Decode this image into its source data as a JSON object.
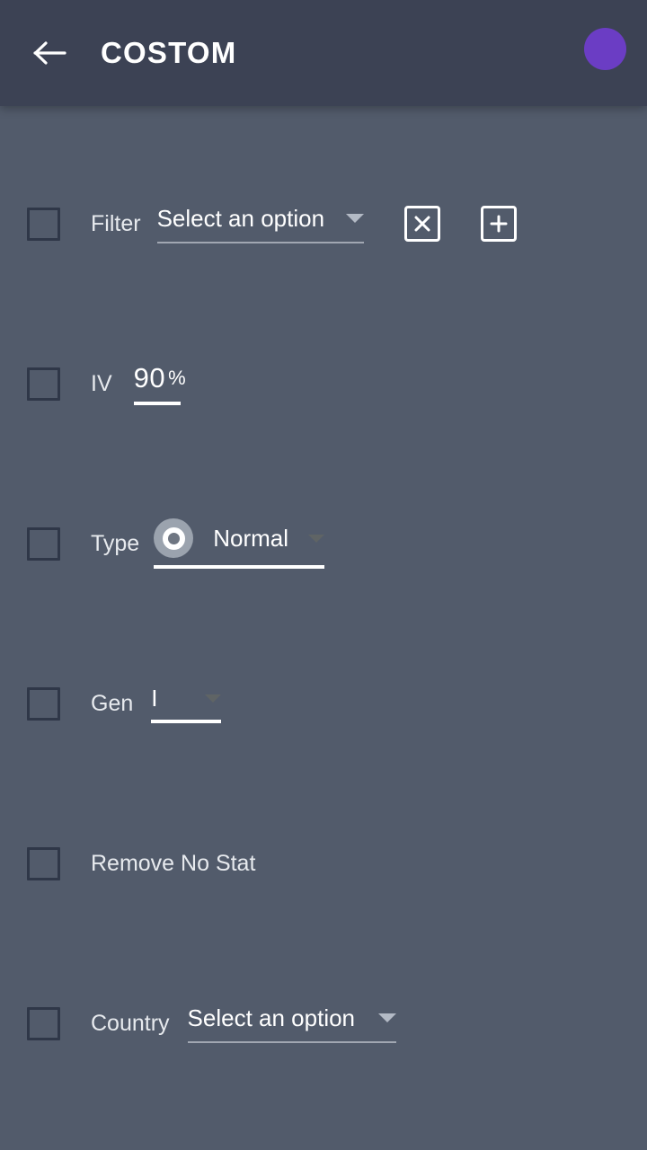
{
  "appbar": {
    "back_icon": "arrow-left-icon",
    "title": "COSTOM",
    "avatar_color": "#6b3dc4"
  },
  "theme": {
    "appbar_bg": "#3c4254",
    "body_bg": "#525b6b",
    "checkbox_border": "#2f3748",
    "text_primary": "#ffffff",
    "label_color": "#e7eaee",
    "underline_active": "#ffffff",
    "underline_inactive": "rgba(226,230,236,0.55)",
    "accent_purple": "#6b3dc4"
  },
  "form": {
    "rows": [
      {
        "name": "filter",
        "label": "Filter",
        "checked": false,
        "control": "dropdown",
        "value": "Select an option",
        "placeholder": "Select an option",
        "focused": false,
        "buttons": [
          {
            "name": "clear-filter-button",
            "icon": "close-box-icon",
            "label": "X"
          },
          {
            "name": "add-filter-button",
            "icon": "plus-box-icon",
            "label": "+"
          }
        ]
      },
      {
        "name": "iv",
        "label": "IV",
        "checked": false,
        "control": "number",
        "value": "90",
        "suffix": "%",
        "focused": true
      },
      {
        "name": "type",
        "label": "Type",
        "checked": false,
        "control": "dropdown-with-icon",
        "value": "Normal",
        "icon": "normal-type-icon",
        "focused": true
      },
      {
        "name": "gen",
        "label": "Gen",
        "checked": false,
        "control": "dropdown",
        "value": "I",
        "focused": true
      },
      {
        "name": "remove-no-stat",
        "label": "Remove No Stat",
        "checked": false,
        "control": "none"
      },
      {
        "name": "country",
        "label": "Country",
        "checked": false,
        "control": "dropdown",
        "value": "Select an option",
        "placeholder": "Select an option",
        "focused": false
      }
    ]
  }
}
